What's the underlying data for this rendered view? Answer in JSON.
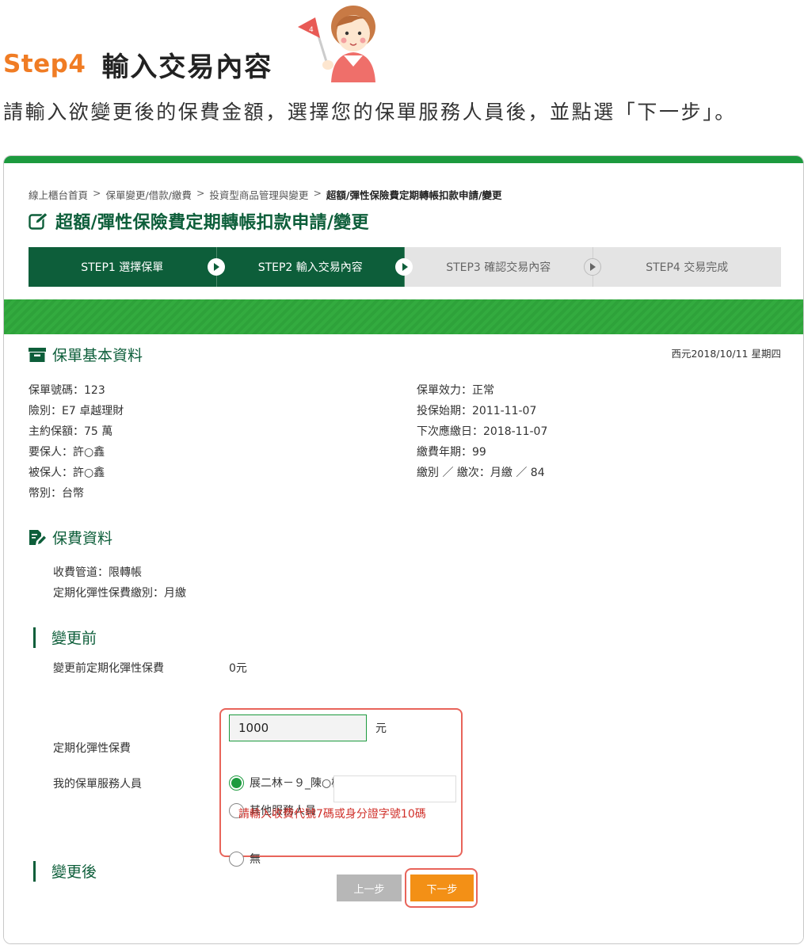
{
  "guide": {
    "step_label": "Step4",
    "title": "輸入交易內容",
    "flag_number": "4",
    "description": "請輸入欲變更後的保費金額，選擇您的保單服務人員後，並點選「下一步」。"
  },
  "breadcrumb": {
    "items": [
      "線上櫃台首頁",
      "保單變更/借款/繳費",
      "投資型商品管理與變更"
    ],
    "separator": ">",
    "current": "超額/彈性保險費定期轉帳扣款申請/變更"
  },
  "page_title": "超額/彈性保險費定期轉帳扣款申請/變更",
  "steps": [
    {
      "label": "STEP1 選擇保單",
      "state": "done"
    },
    {
      "label": "STEP2 輸入交易內容",
      "state": "active"
    },
    {
      "label": "STEP3 確認交易內容",
      "state": "pending"
    },
    {
      "label": "STEP4 交易完成",
      "state": "pending"
    }
  ],
  "date_stamp": "西元2018/10/11 星期四",
  "policy_info": {
    "heading": "保單基本資料",
    "left": [
      {
        "key": "保單號碼：",
        "value": "123"
      },
      {
        "key": "險別：",
        "value": "E7 卓越理財"
      },
      {
        "key": "主約保額：",
        "value": "75 萬"
      },
      {
        "key": "要保人：",
        "value": "許○鑫"
      },
      {
        "key": "被保人：",
        "value": "許○鑫"
      },
      {
        "key": "幣別：",
        "value": "台幣"
      }
    ],
    "right": [
      {
        "key": "保單效力：",
        "value": "正常"
      },
      {
        "key": "投保始期：",
        "value": "2011-11-07"
      },
      {
        "key": "下次應繳日：",
        "value": "2018-11-07"
      },
      {
        "key": "繳費年期：",
        "value": "99"
      },
      {
        "key": "繳別 ／ 繳次：",
        "value": "月繳 ／ 84"
      }
    ]
  },
  "premium_info": {
    "heading": "保費資料",
    "lines": [
      {
        "key": "收費管道：",
        "value": "限轉帳"
      },
      {
        "key": "定期化彈性保費繳別：",
        "value": "月繳"
      }
    ]
  },
  "before_change": {
    "heading": "變更前",
    "label": "變更前定期化彈性保費",
    "value": "0元"
  },
  "after_change": {
    "heading": "變更後",
    "amount_label": "定期化彈性保費",
    "amount_value": "1000",
    "amount_unit": "元",
    "agent_label": "我的保單服務人員",
    "agent_options": [
      {
        "label": "展二林－９_陳○桃",
        "checked": true
      },
      {
        "label": "其他服務人員",
        "checked": false
      },
      {
        "label": "無",
        "checked": false
      }
    ],
    "other_agent_value": "",
    "error_message": "請輸入收費代號7碼或身分證字號10碼"
  },
  "buttons": {
    "prev": "上一步",
    "next": "下一步"
  },
  "colors": {
    "brand_green": "#0d5e3a",
    "stripe_green": "#1c9a3e",
    "accent_orange": "#f39016",
    "step_title_orange": "#f07c24",
    "highlight_red": "#e8645a",
    "error_red": "#d0302a"
  }
}
